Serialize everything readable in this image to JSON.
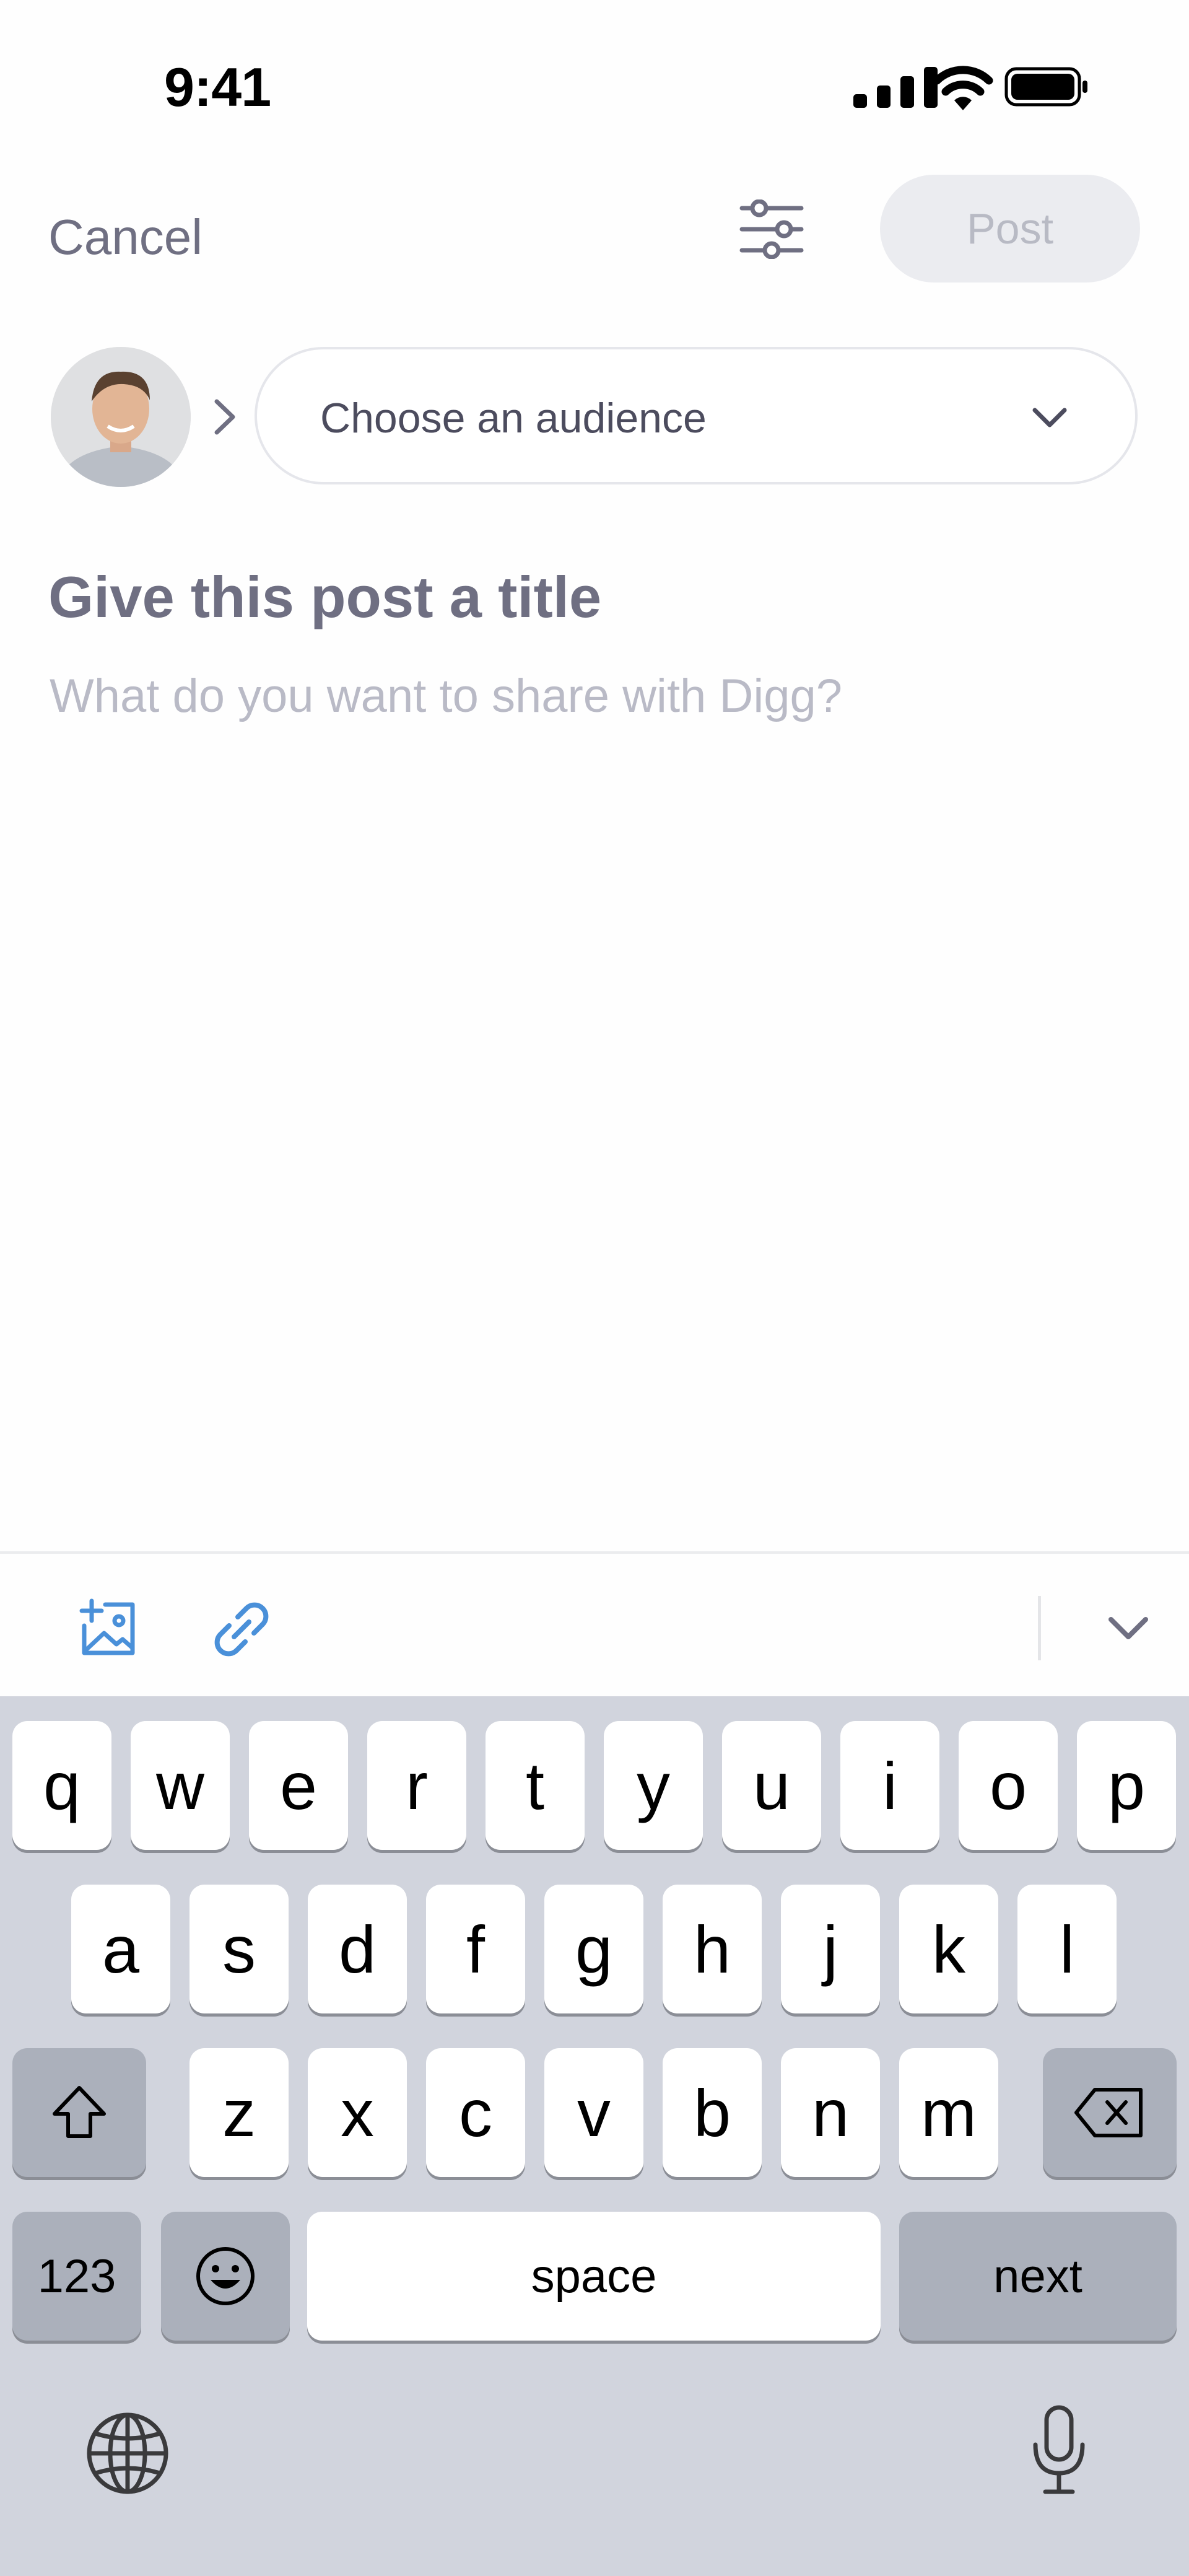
{
  "status_bar": {
    "time": "9:41"
  },
  "header": {
    "cancel_label": "Cancel",
    "post_label": "Post",
    "filter_icon": "sliders-icon"
  },
  "audience": {
    "placeholder": "Choose an audience"
  },
  "composer": {
    "title_placeholder": "Give this post a title",
    "body_placeholder": "What do you want to share with Digg?"
  },
  "toolbar": {
    "icons": [
      "add-image-icon",
      "link-icon",
      "collapse-chevron-icon"
    ]
  },
  "keyboard": {
    "row1": [
      "q",
      "w",
      "e",
      "r",
      "t",
      "y",
      "u",
      "i",
      "o",
      "p"
    ],
    "row2": [
      "a",
      "s",
      "d",
      "f",
      "g",
      "h",
      "j",
      "k",
      "l"
    ],
    "row3": [
      "z",
      "x",
      "c",
      "v",
      "b",
      "n",
      "m"
    ],
    "numbers_label": "123",
    "space_label": "space",
    "next_label": "next"
  },
  "colors": {
    "muted_text": "#6f6f82",
    "accent_blue": "#4a90d9",
    "keyboard_bg": "#d1d4dd"
  }
}
